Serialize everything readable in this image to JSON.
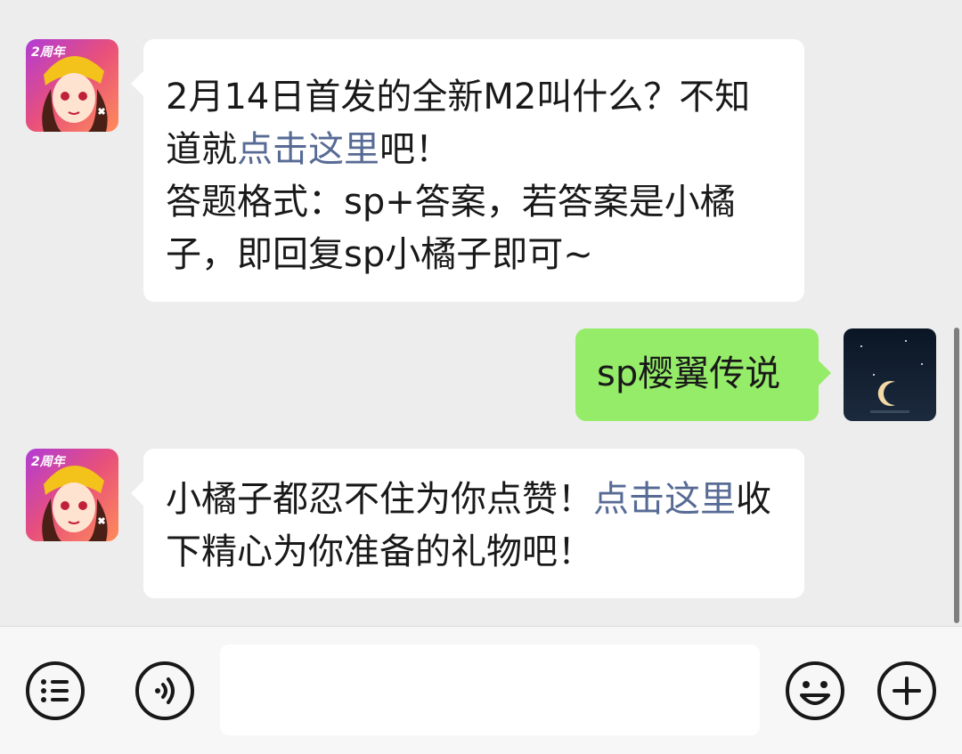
{
  "messages": [
    {
      "side": "left",
      "avatar_badge": "2周年",
      "parts": [
        {
          "t": "2月14日首发的全新M2叫什么？不知道就"
        },
        {
          "t": "点击这里",
          "link": true
        },
        {
          "t": "吧！"
        },
        {
          "br": true
        },
        {
          "t": "答题格式：sp+答案，若答案是小橘子，即回复sp小橘子即可~"
        }
      ]
    },
    {
      "side": "right",
      "text": "sp樱翼传说"
    },
    {
      "side": "left",
      "avatar_badge": "2周年",
      "parts": [
        {
          "t": "小橘子都忍不住为你点赞！"
        },
        {
          "t": "点击这里",
          "link": true
        },
        {
          "t": "收下精心为你准备的礼物吧！"
        }
      ]
    }
  ],
  "input": {
    "value": "",
    "left_icons": [
      "menu-list-icon",
      "voice-icon"
    ],
    "right_icons": [
      "emoji-icon",
      "plus-icon"
    ]
  }
}
